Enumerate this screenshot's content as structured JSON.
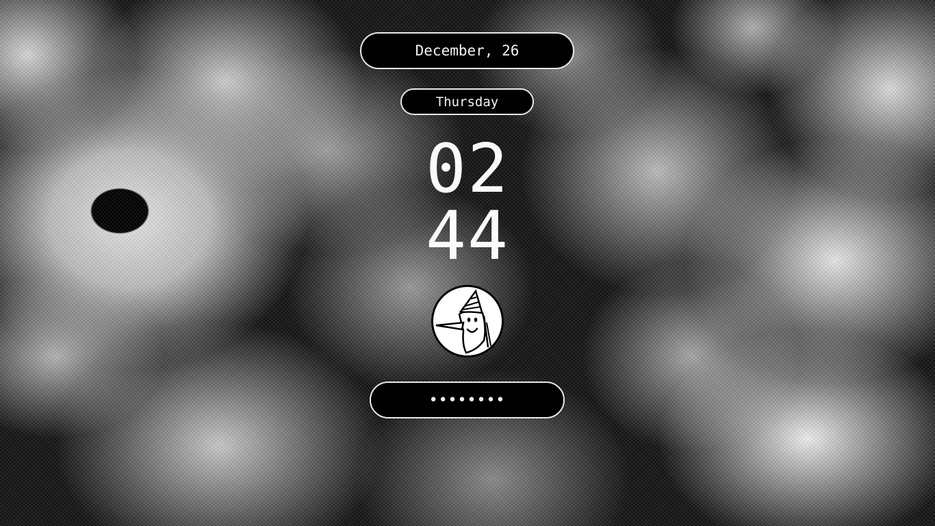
{
  "lockscreen": {
    "date": "December, 26",
    "weekday": "Thursday",
    "clock": {
      "hours": "02",
      "minutes": "44"
    },
    "avatar": {
      "icon": "wizard-avatar-icon"
    },
    "password": {
      "masked_value": "••••••••"
    }
  },
  "colors": {
    "pill_background": "#000000",
    "pill_border": "#e8e8e8",
    "text": "#f2f2f2"
  }
}
